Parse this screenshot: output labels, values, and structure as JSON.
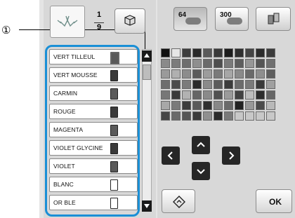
{
  "callout": {
    "marker": "①"
  },
  "preview": {
    "thread_counter": {
      "current": "1",
      "total": "9"
    }
  },
  "toolbar": {
    "palette_64_label": "64",
    "palette_300_label": "300",
    "thread_button_icon": "spool-cube-icon",
    "user_palette_icon": "spool-stack-icon"
  },
  "thread_list": {
    "items": [
      {
        "label": "VERT TILLEUL",
        "selected": true
      },
      {
        "label": "VERT MOUSSE"
      },
      {
        "label": "CARMIN"
      },
      {
        "label": "ROUGE"
      },
      {
        "label": "MAGENTA"
      },
      {
        "label": "VIOLET GLYCINE"
      },
      {
        "label": "VIOLET"
      },
      {
        "label": "BLANC"
      },
      {
        "label": "OR BLE"
      }
    ]
  },
  "palette": {
    "colors": [
      [
        "#111111",
        "#e6e6e6",
        "#3d3d3d",
        "#2a2a2a",
        "#5a5a5a",
        "#3a3a3a",
        "#1c1c1c",
        "#2e2e2e",
        "#444444",
        "#2c2c2c",
        "#3c3c3c"
      ],
      [
        "#8a8a8a",
        "#7c7c7c",
        "#6e6e6e",
        "#8f8f8f",
        "#6b6b6b",
        "#4e4e4e",
        "#7a7a7a",
        "#5e5e5e",
        "#969696",
        "#555555",
        "#707070"
      ],
      [
        "#9a9a9a",
        "#b0b0b0",
        "#8c8c8c",
        "#5a5a5a",
        "#9c9c9c",
        "#7a7a7a",
        "#a6a6a6",
        "#8a8a8a",
        "#6a6a6a",
        "#8e8e8e",
        "#5e5e5e"
      ],
      [
        "#6e6e6e",
        "#4a4a4a",
        "#7b7b7b",
        "#2a2a2a",
        "#8a8a8a",
        "#5c5c5c",
        "#3b3b3b",
        "#6c6c6c",
        "#7a7a7a",
        "#3a3a3a",
        "#a0a0a0"
      ],
      [
        "#777777",
        "#3a3a3a",
        "#b2b2b2",
        "#666666",
        "#8a8a8a",
        "#505050",
        "#9a9a9a",
        "#424242",
        "#bdbdbd",
        "#2c2c2c",
        "#666666"
      ],
      [
        "#a8a8a8",
        "#7a7a7a",
        "#3c3c3c",
        "#5a5a5a",
        "#303030",
        "#888888",
        "#6a6a6a",
        "#222222",
        "#989898",
        "#4a4a4a",
        "#b8b8b8"
      ],
      [
        "#474747",
        "#6a6a6a",
        "#555555",
        "#3a3a3a",
        "#909090",
        "#2a2a2a",
        "#7a7a7a",
        "#c8c8c8",
        "#c8c8c8",
        "#c8c8c8",
        "#c8c8c8"
      ]
    ]
  },
  "controls": {
    "left_arrow_icon": "chevron-left-icon",
    "up_arrow_icon": "chevron-up-icon",
    "right_arrow_icon": "chevron-right-icon",
    "down_arrow_icon": "chevron-down-icon",
    "reset_icon": "reset-diamond-icon",
    "ok_label": "OK"
  }
}
